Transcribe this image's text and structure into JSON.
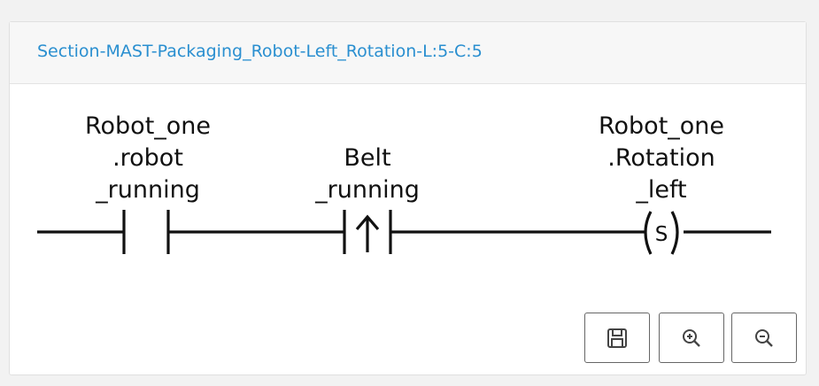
{
  "panel": {
    "title": "Section-MAST-Packaging_Robot-Left_Rotation-L:5-C:5"
  },
  "rung": {
    "contact_1": {
      "type": "normally-open-contact",
      "label_lines": [
        "Robot_one",
        ".robot",
        "_running"
      ]
    },
    "contact_2": {
      "type": "rising-edge-contact",
      "label_lines": [
        "Belt",
        "_running"
      ]
    },
    "coil_1": {
      "type": "set-coil",
      "symbol": "S",
      "label_lines": [
        "Robot_one",
        ".Rotation",
        "_left"
      ]
    }
  },
  "toolbar": {
    "buttons": [
      {
        "name": "save",
        "icon": "floppy-disk-icon"
      },
      {
        "name": "zoom-in",
        "icon": "zoom-in-icon"
      },
      {
        "name": "zoom-out",
        "icon": "zoom-out-icon"
      }
    ]
  }
}
